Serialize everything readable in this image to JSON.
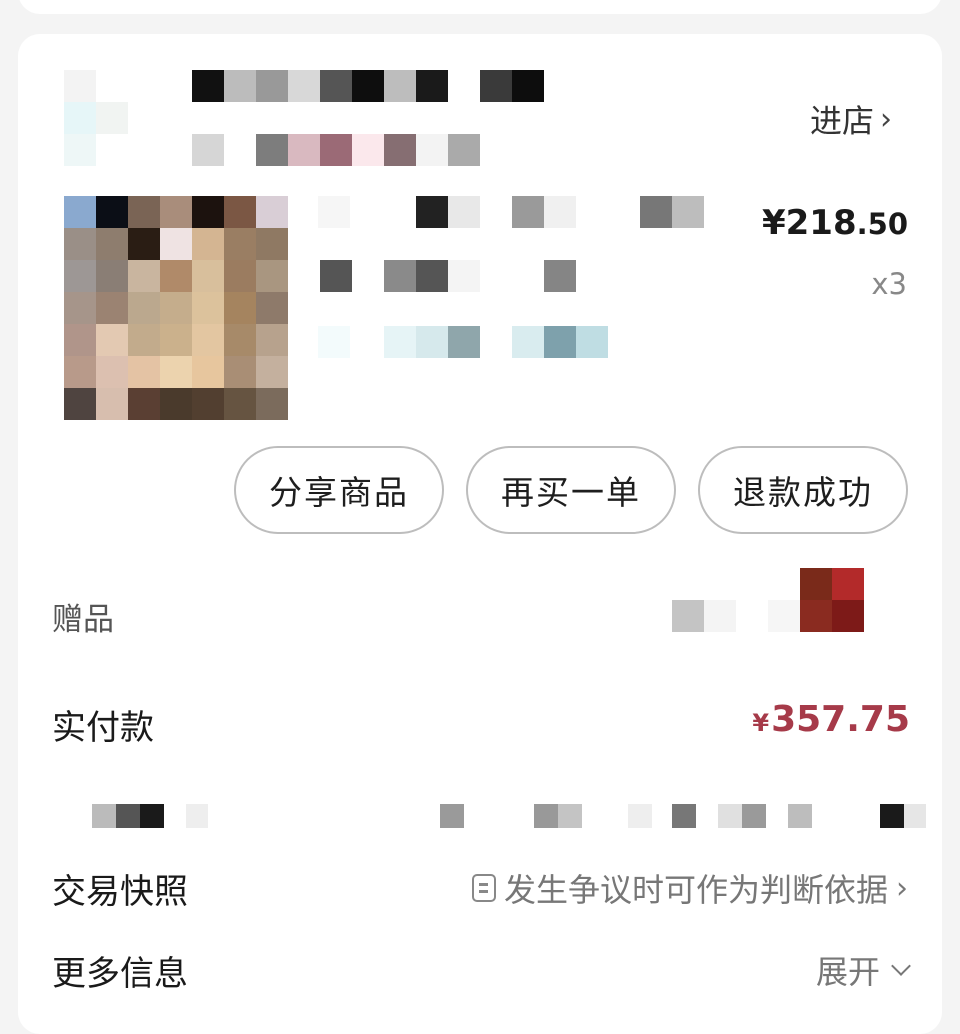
{
  "shop": {
    "enter_label": "进店"
  },
  "product": {
    "price_int": "¥218",
    "price_dec": ".50",
    "quantity": "x3"
  },
  "actions": [
    {
      "label": "分享商品"
    },
    {
      "label": "再买一单"
    },
    {
      "label": "退款成功"
    }
  ],
  "gift": {
    "label": "赠品"
  },
  "payment": {
    "label": "实付款",
    "currency": "¥",
    "amount": "357.75",
    "color": "#a63a49"
  },
  "snapshot": {
    "label": "交易快照",
    "note": "发生争议时可作为判断依据"
  },
  "more_info": {
    "label": "更多信息",
    "toggle_label": "展开"
  }
}
